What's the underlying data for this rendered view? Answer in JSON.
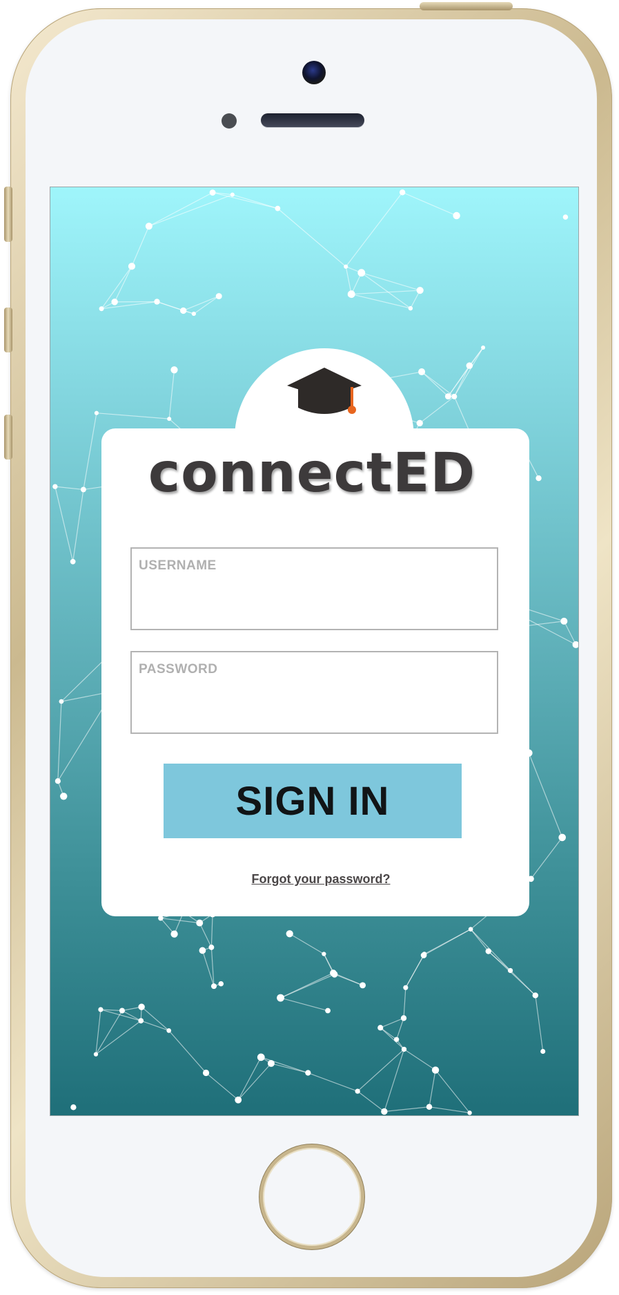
{
  "app": {
    "brand_name": "connectED",
    "logo_icon": "graduation-cap-icon"
  },
  "login": {
    "username_label": "USERNAME",
    "username_value": "",
    "password_label": "PASSWORD",
    "password_value": "",
    "sign_in_label": "SIGN IN",
    "forgot_password_label": "Forgot your password?"
  },
  "colors": {
    "background_top": "#9ff5fb",
    "background_bottom": "#1f6f79",
    "sign_in_button": "#7ec7dc",
    "brand_text": "#3d3a3b",
    "tassel": "#e8661f"
  }
}
